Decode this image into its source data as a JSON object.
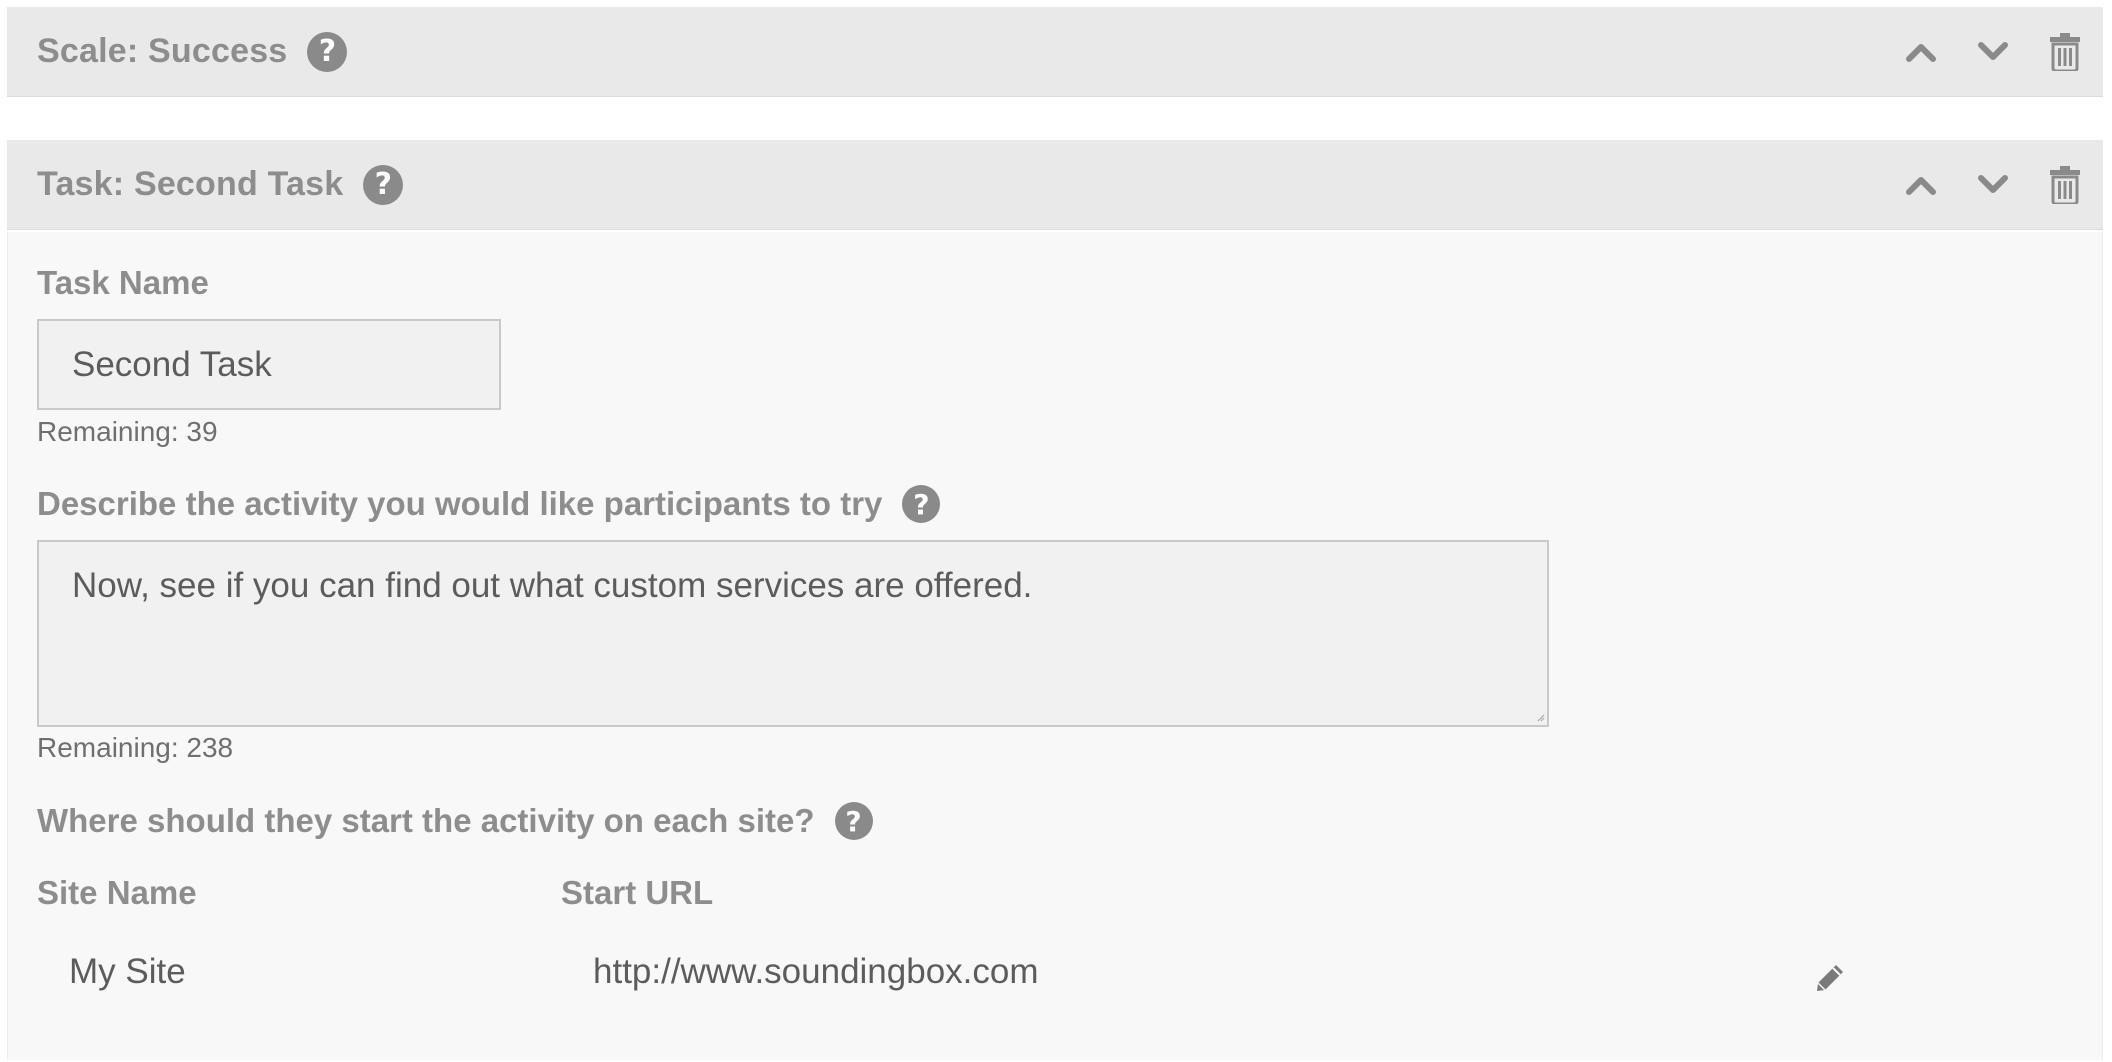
{
  "scale_panel": {
    "title": "Scale: Success",
    "help_icon": "question-circle-icon",
    "actions": [
      "chevron-up-icon",
      "chevron-down-icon",
      "trash-icon"
    ]
  },
  "task_panel": {
    "title": "Task: Second Task",
    "help_icon": "question-circle-icon",
    "actions": [
      "chevron-up-icon",
      "chevron-down-icon",
      "trash-icon"
    ],
    "task_name": {
      "label": "Task Name",
      "value": "Second Task",
      "remaining": "Remaining: 39"
    },
    "description": {
      "label": "Describe the activity you would like participants to try",
      "value": "Now, see if you can find out what custom services are offered.",
      "remaining": "Remaining: 238"
    },
    "start_location": {
      "label": "Where should they start the activity on each site?",
      "columns": [
        "Site Name",
        "Start URL"
      ],
      "rows": [
        {
          "site_name": "My Site",
          "start_url": "http://www.soundingbox.com",
          "action_icon": "pencil-icon"
        }
      ]
    }
  },
  "colors": {
    "header_bg": "#e9e9e9",
    "body_bg": "#f8f8f8",
    "icon_gray": "#8a8a8a",
    "input_bg": "#f1f1f1"
  }
}
